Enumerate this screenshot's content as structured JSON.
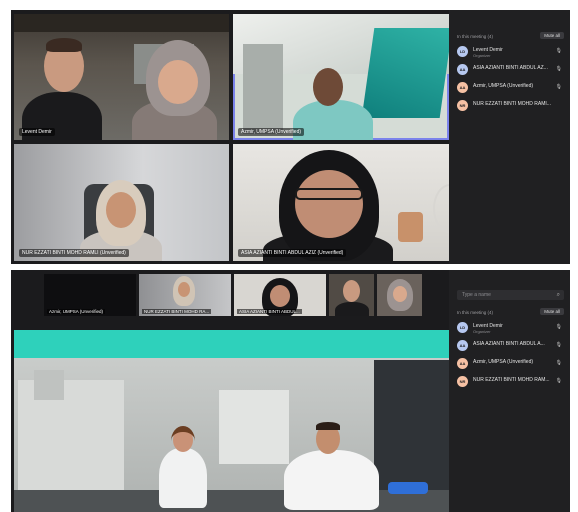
{
  "top": {
    "tiles": [
      {
        "name": "Levent Demir"
      },
      {
        "name": "Azmir, UMPSA (Unverified)"
      },
      {
        "name": "NUR EZZATI BINTI MOHD RAMLI (Unverified)"
      },
      {
        "name": "ASIA AZIANTI BINTI ABDUL AZIZ (Unverified)"
      }
    ],
    "panel": {
      "title": "",
      "section": "In this meeting (4)",
      "mute_all": "Mute all",
      "participants": [
        {
          "initials": "LD",
          "name": "Levent Demir",
          "role": "Organizer",
          "color": "#b6c8f0"
        },
        {
          "initials": "AA",
          "name": "ASIA AZIANTI BINTI ABDUL AZ...",
          "role": "",
          "color": "#b6c8f0"
        },
        {
          "initials": "AA",
          "name": "Azmir, UMPSA (Unverified)",
          "role": "",
          "color": "#f6c1a4"
        },
        {
          "initials": "NR",
          "name": "NUR EZZATI BINTI MOHD RAMI...",
          "role": "",
          "color": "#f6c1a4"
        }
      ]
    }
  },
  "bottom": {
    "thumbs": [
      {
        "name": "Azmir, UMPSA (Unverified)"
      },
      {
        "name": "NUR EZZATI BINTI MOHD RA..."
      },
      {
        "name": "ASIA AZIANTI BINTI ABDUL..."
      },
      {
        "name": ""
      },
      {
        "name": ""
      }
    ],
    "panel": {
      "title": "",
      "search_placeholder": "Type a name",
      "section": "In this meeting (4)",
      "mute_all": "Mute all",
      "participants": [
        {
          "initials": "LD",
          "name": "Levent Demir",
          "role": "Organizer",
          "color": "#b6c8f0"
        },
        {
          "initials": "AA",
          "name": "ASIA AZIANTI BINTI ABDUL A...",
          "role": "",
          "color": "#b6c8f0"
        },
        {
          "initials": "AA",
          "name": "Azmir, UMPSA (Unverified)",
          "role": "",
          "color": "#f6c1a4"
        },
        {
          "initials": "NR",
          "name": "NUR EZZATI BINTI MOHD RAM...",
          "role": "",
          "color": "#f6c1a4"
        }
      ]
    }
  }
}
